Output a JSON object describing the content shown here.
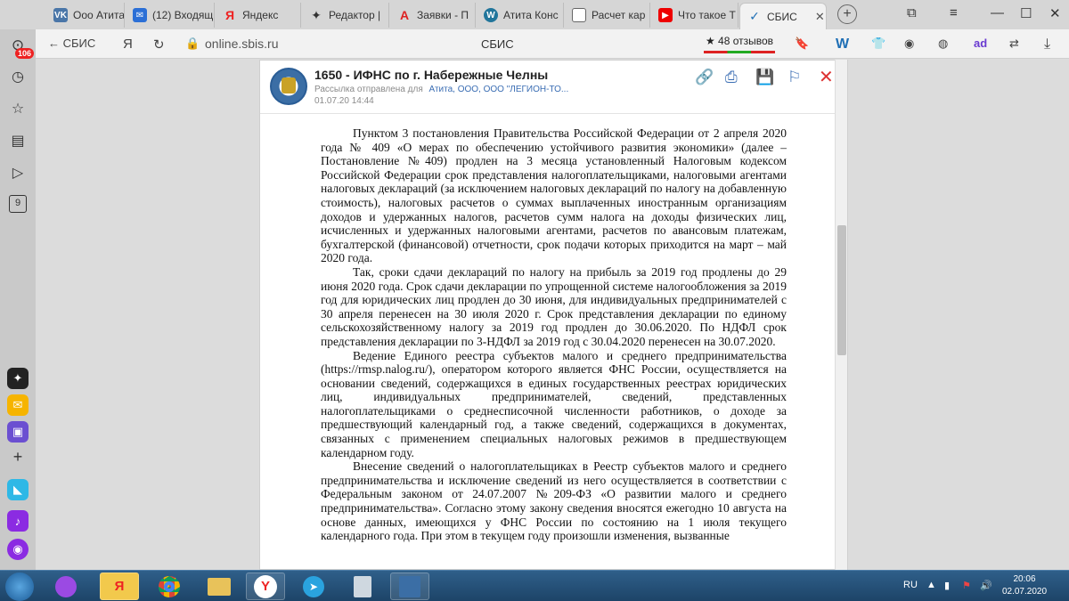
{
  "browser": {
    "tabs": [
      {
        "label": "Ооо Атита",
        "icon": "vk-icon",
        "color": "#4a76a8"
      },
      {
        "label": "(12) Входящ",
        "icon": "mail-icon",
        "color": "#2b6fd6"
      },
      {
        "label": "Яндекс",
        "icon": "yandex-icon",
        "color": "#e22"
      },
      {
        "label": "Редактор |",
        "icon": "spark-icon",
        "color": "#333"
      },
      {
        "label": "Заявки - П",
        "icon": "acrobat-icon",
        "color": "#d22"
      },
      {
        "label": "Атита Конс",
        "icon": "wordpress-icon",
        "color": "#21759b"
      },
      {
        "label": "Расчет кар",
        "icon": "doc-icon",
        "color": "#666"
      },
      {
        "label": "Что такое Т",
        "icon": "youtube-icon",
        "color": "#e00"
      },
      {
        "label": "СБИС",
        "icon": "sbis-icon",
        "color": "#1f6fb5",
        "active": true
      }
    ],
    "back_label": "СБИС",
    "url": "online.sbis.ru",
    "page_title": "СБИС",
    "reviews_label": "★ 48 отзывов"
  },
  "sidebar": {
    "badge": "106",
    "nav_icons": [
      "clock-icon",
      "star-icon",
      "collections-icon",
      "play-icon",
      "tab-count-icon"
    ],
    "tab_count": "9"
  },
  "document": {
    "title": "1650 - ИФНС по г. Набережные Челны",
    "sent_label": "Рассылка отправлена для",
    "recipients": "Атита, ООО, ООО \"ЛЕГИОН-ТО...",
    "date": "01.07.20 14:44",
    "paragraphs": [
      "Пунктом 3 постановления Правительства Российской Федерации от 2 апреля 2020 года № 409 «О мерах по обеспечению устойчивого развития экономики» (далее – Постановление №409) продлен на 3 месяца установленный Налоговым кодексом Российской Федерации срок представления налогоплательщиками, налоговыми агентами налоговых деклараций (за исключением налоговых деклараций по налогу на добавленную стоимость), налоговых расчетов о суммах выплаченных иностранным организациям доходов и удержанных налогов, расчетов сумм налога на доходы физических лиц, исчисленных и удержанных налоговыми агентами, расчетов по авансовым платежам, бухгалтерской (финансовой) отчетности, срок подачи которых приходится на март – май 2020 года.",
      "Так, сроки сдачи деклараций по налогу на прибыль за 2019 год продлены до 29 июня 2020 года. Срок сдачи декларации по упрощенной системе налогообложения за 2019 год для юридических лиц продлен до 30 июня, для индивидуальных предпринимателей с 30 апреля перенесен на 30 июля 2020 г. Срок представления декларации по единому сельскохозяйственному налогу за 2019 год продлен до 30.06.2020. По НДФЛ срок представления декларации по 3-НДФЛ за 2019 год с 30.04.2020 перенесен на 30.07.2020.",
      "Ведение Единого реестра субъектов малого и среднего предпринимательства (https://rmsp.nalog.ru/), оператором которого является ФНС России, осуществляется на основании сведений, содержащихся в единых государственных реестрах юридических лиц, индивидуальных предпринимателей, сведений, представленных налогоплательщиками о среднесписочной численности работников, о доходе за предшествующий календарный год, а также сведений, содержащихся в документах, связанных с применением специальных налоговых режимов в предшествующем календарном году.",
      "Внесение сведений о налогоплательщиках в Реестр субъектов малого и среднего предпринимательства и исключение сведений из него осуществляется в соответствии с Федеральным законом от 24.07.2007 №209-ФЗ «О развитии малого и среднего предпринимательства». Согласно этому закону сведения вносятся ежегодно 10 августа на основе данных, имеющихся у ФНС России по состоянию на 1 июля текущего календарного года. При этом в текущем году произошли изменения, вызванные"
    ]
  },
  "taskbar": {
    "lang": "RU",
    "time": "20:06",
    "date": "02.07.2020"
  }
}
